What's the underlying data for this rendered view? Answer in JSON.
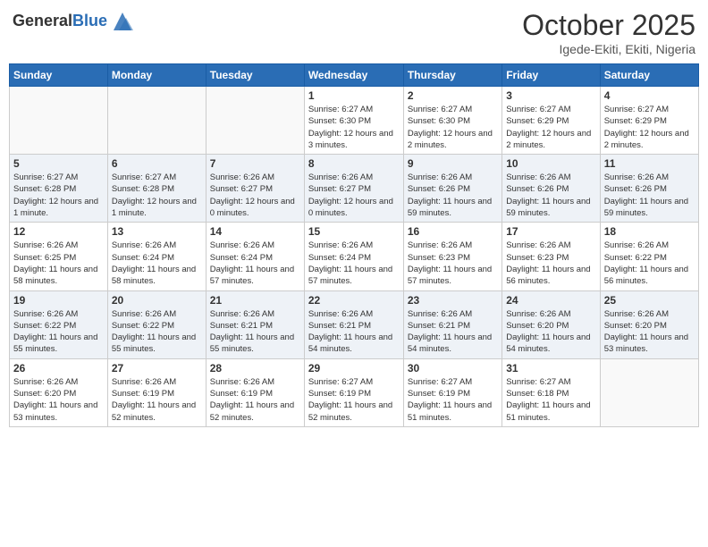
{
  "logo": {
    "general": "General",
    "blue": "Blue"
  },
  "header": {
    "month": "October 2025",
    "location": "Igede-Ekiti, Ekiti, Nigeria"
  },
  "weekdays": [
    "Sunday",
    "Monday",
    "Tuesday",
    "Wednesday",
    "Thursday",
    "Friday",
    "Saturday"
  ],
  "weeks": [
    [
      {
        "day": "",
        "info": ""
      },
      {
        "day": "",
        "info": ""
      },
      {
        "day": "",
        "info": ""
      },
      {
        "day": "1",
        "info": "Sunrise: 6:27 AM\nSunset: 6:30 PM\nDaylight: 12 hours and 3 minutes."
      },
      {
        "day": "2",
        "info": "Sunrise: 6:27 AM\nSunset: 6:30 PM\nDaylight: 12 hours and 2 minutes."
      },
      {
        "day": "3",
        "info": "Sunrise: 6:27 AM\nSunset: 6:29 PM\nDaylight: 12 hours and 2 minutes."
      },
      {
        "day": "4",
        "info": "Sunrise: 6:27 AM\nSunset: 6:29 PM\nDaylight: 12 hours and 2 minutes."
      }
    ],
    [
      {
        "day": "5",
        "info": "Sunrise: 6:27 AM\nSunset: 6:28 PM\nDaylight: 12 hours and 1 minute."
      },
      {
        "day": "6",
        "info": "Sunrise: 6:27 AM\nSunset: 6:28 PM\nDaylight: 12 hours and 1 minute."
      },
      {
        "day": "7",
        "info": "Sunrise: 6:26 AM\nSunset: 6:27 PM\nDaylight: 12 hours and 0 minutes."
      },
      {
        "day": "8",
        "info": "Sunrise: 6:26 AM\nSunset: 6:27 PM\nDaylight: 12 hours and 0 minutes."
      },
      {
        "day": "9",
        "info": "Sunrise: 6:26 AM\nSunset: 6:26 PM\nDaylight: 11 hours and 59 minutes."
      },
      {
        "day": "10",
        "info": "Sunrise: 6:26 AM\nSunset: 6:26 PM\nDaylight: 11 hours and 59 minutes."
      },
      {
        "day": "11",
        "info": "Sunrise: 6:26 AM\nSunset: 6:26 PM\nDaylight: 11 hours and 59 minutes."
      }
    ],
    [
      {
        "day": "12",
        "info": "Sunrise: 6:26 AM\nSunset: 6:25 PM\nDaylight: 11 hours and 58 minutes."
      },
      {
        "day": "13",
        "info": "Sunrise: 6:26 AM\nSunset: 6:24 PM\nDaylight: 11 hours and 58 minutes."
      },
      {
        "day": "14",
        "info": "Sunrise: 6:26 AM\nSunset: 6:24 PM\nDaylight: 11 hours and 57 minutes."
      },
      {
        "day": "15",
        "info": "Sunrise: 6:26 AM\nSunset: 6:24 PM\nDaylight: 11 hours and 57 minutes."
      },
      {
        "day": "16",
        "info": "Sunrise: 6:26 AM\nSunset: 6:23 PM\nDaylight: 11 hours and 57 minutes."
      },
      {
        "day": "17",
        "info": "Sunrise: 6:26 AM\nSunset: 6:23 PM\nDaylight: 11 hours and 56 minutes."
      },
      {
        "day": "18",
        "info": "Sunrise: 6:26 AM\nSunset: 6:22 PM\nDaylight: 11 hours and 56 minutes."
      }
    ],
    [
      {
        "day": "19",
        "info": "Sunrise: 6:26 AM\nSunset: 6:22 PM\nDaylight: 11 hours and 55 minutes."
      },
      {
        "day": "20",
        "info": "Sunrise: 6:26 AM\nSunset: 6:22 PM\nDaylight: 11 hours and 55 minutes."
      },
      {
        "day": "21",
        "info": "Sunrise: 6:26 AM\nSunset: 6:21 PM\nDaylight: 11 hours and 55 minutes."
      },
      {
        "day": "22",
        "info": "Sunrise: 6:26 AM\nSunset: 6:21 PM\nDaylight: 11 hours and 54 minutes."
      },
      {
        "day": "23",
        "info": "Sunrise: 6:26 AM\nSunset: 6:21 PM\nDaylight: 11 hours and 54 minutes."
      },
      {
        "day": "24",
        "info": "Sunrise: 6:26 AM\nSunset: 6:20 PM\nDaylight: 11 hours and 54 minutes."
      },
      {
        "day": "25",
        "info": "Sunrise: 6:26 AM\nSunset: 6:20 PM\nDaylight: 11 hours and 53 minutes."
      }
    ],
    [
      {
        "day": "26",
        "info": "Sunrise: 6:26 AM\nSunset: 6:20 PM\nDaylight: 11 hours and 53 minutes."
      },
      {
        "day": "27",
        "info": "Sunrise: 6:26 AM\nSunset: 6:19 PM\nDaylight: 11 hours and 52 minutes."
      },
      {
        "day": "28",
        "info": "Sunrise: 6:26 AM\nSunset: 6:19 PM\nDaylight: 11 hours and 52 minutes."
      },
      {
        "day": "29",
        "info": "Sunrise: 6:27 AM\nSunset: 6:19 PM\nDaylight: 11 hours and 52 minutes."
      },
      {
        "day": "30",
        "info": "Sunrise: 6:27 AM\nSunset: 6:19 PM\nDaylight: 11 hours and 51 minutes."
      },
      {
        "day": "31",
        "info": "Sunrise: 6:27 AM\nSunset: 6:18 PM\nDaylight: 11 hours and 51 minutes."
      },
      {
        "day": "",
        "info": ""
      }
    ]
  ]
}
